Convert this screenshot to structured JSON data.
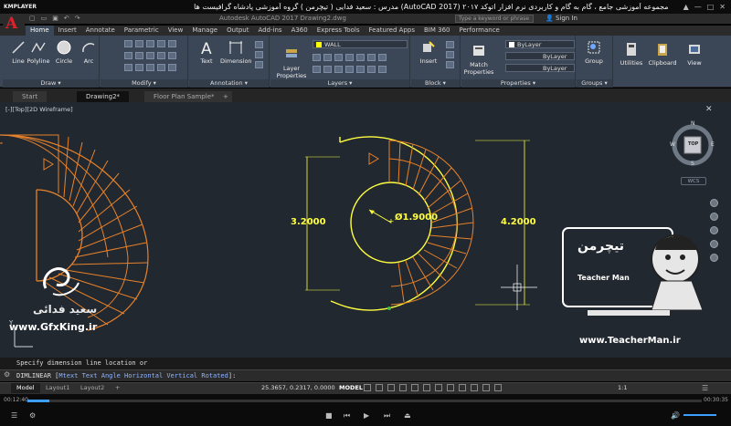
{
  "kmplayer": {
    "logo": "KMPLAYER",
    "video_title": "مجموعه آموزشی جامع ، گام به گام و کاربردی نرم افزار اتوکد ۲۰۱۷ (AutoCAD 2017) مدرس : سعید فدایی ( تیچرمن ) گروه آموزشی پادشاه گرافیست ها",
    "win_buttons": [
      "▲",
      "—",
      "□",
      "✕"
    ]
  },
  "autocad": {
    "logo_letter": "A",
    "doc_title": "Autodesk AutoCAD 2017  Drawing2.dwg",
    "search_placeholder": "Type a keyword or phrase",
    "signin": "Sign In"
  },
  "ribbon_tabs": [
    "Home",
    "Insert",
    "Annotate",
    "Parametric",
    "View",
    "Manage",
    "Output",
    "Add-ins",
    "A360",
    "Express Tools",
    "Featured Apps",
    "BIM 360",
    "Performance"
  ],
  "active_tab": "Home",
  "panels": {
    "draw": {
      "title": "Draw ▾",
      "tools": [
        "Line",
        "Polyline",
        "Circle",
        "Arc"
      ]
    },
    "modify": {
      "title": "Modify ▾"
    },
    "annotation": {
      "title": "Annotation ▾",
      "tools": [
        "Text",
        "Dimension"
      ]
    },
    "layers": {
      "title": "Layers ▾",
      "tool": "Layer Properties",
      "current_layer": "WALL"
    },
    "block": {
      "title": "Block ▾",
      "tool": "Insert"
    },
    "properties": {
      "title": "Properties ▾",
      "tool": "Match Properties",
      "color": "ByLayer",
      "linetype": "ByLayer",
      "lineweight": "ByLayer"
    },
    "groups": {
      "title": "Groups ▾",
      "tool": "Group"
    },
    "utilities": {
      "tool": "Utilities"
    },
    "clipboard": {
      "tool": "Clipboard"
    },
    "view": {
      "tool": "View"
    }
  },
  "doc_tabs": [
    "Start",
    "Drawing2*",
    "Floor Plan Sample*",
    "+"
  ],
  "active_doc_tab": "Drawing2*",
  "viewport_label": "[-][Top][2D Wireframe]",
  "viewcube": {
    "top": "TOP",
    "n": "N",
    "s": "S",
    "e": "E",
    "w": "W",
    "wcs": "WCS"
  },
  "dimensions": {
    "left": "3.2000",
    "diameter": "Ø1.9000",
    "right": "4.2000"
  },
  "command": {
    "history": "Specify dimension line location or",
    "prompt": "DIMLINEAR",
    "options": [
      "Mtext",
      "Text",
      "Angle",
      "Horizontal",
      "Vertical",
      "Rotated"
    ]
  },
  "layout_tabs": [
    "Model",
    "Layout1",
    "Layout2",
    "+"
  ],
  "active_layout": "Model",
  "coordinates": "25.3657, 0.2317, 0.0000",
  "model_label": "MODEL",
  "scale": "1:1",
  "watermarks": {
    "left_site": "www.GfxKing.ir",
    "left_name": "سعید فدائی",
    "right_site": "www.TeacherMan.ir",
    "brand_fa": "تیچرمن",
    "brand_en": "Teacher Man"
  },
  "player": {
    "time_elapsed": "00:12:40",
    "time_total": "00:30:35"
  },
  "colors": {
    "accent_yellow": "#ffff00",
    "stair_orange": "#e8822a",
    "dim_yellow": "#e8e800",
    "canvas": "#212830"
  }
}
